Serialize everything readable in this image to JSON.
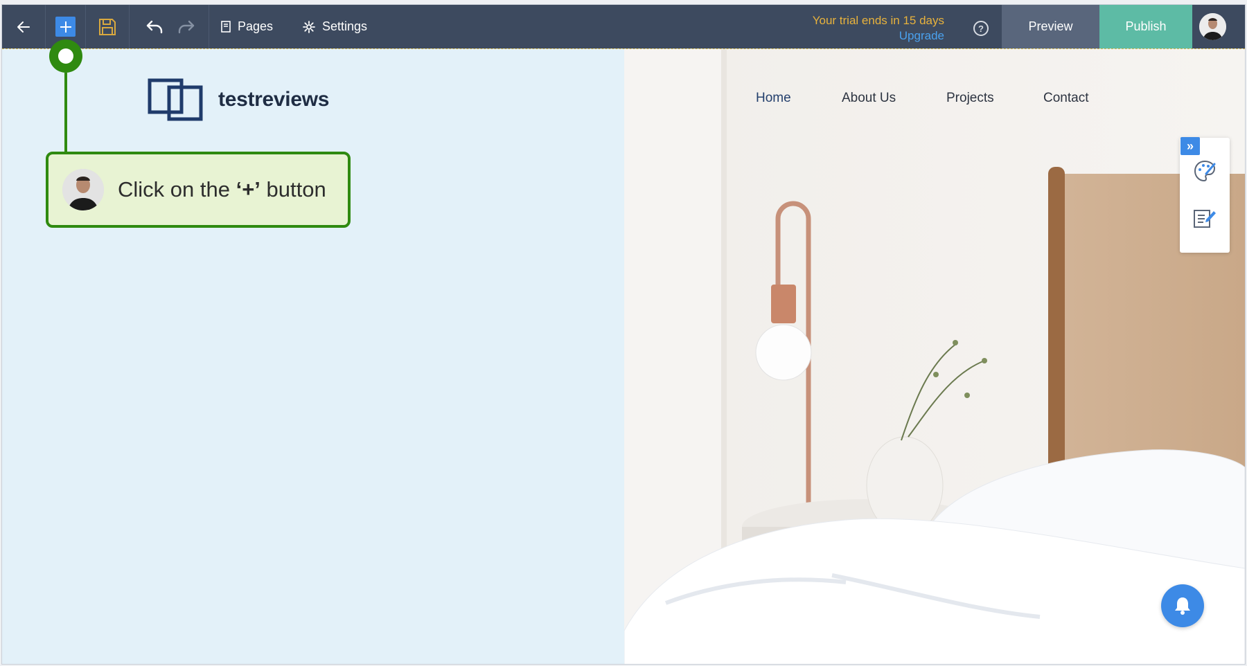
{
  "toolbar": {
    "back_icon": "arrow-left-icon",
    "add_icon": "plus-icon",
    "save_icon": "floppy-disk-icon",
    "undo_icon": "undo-icon",
    "redo_icon": "redo-icon",
    "pages_label": "Pages",
    "settings_label": "Settings",
    "trial_text": "Your trial ends in 15 days",
    "upgrade_label": "Upgrade",
    "help_label": "?",
    "preview_label": "Preview",
    "publish_label": "Publish"
  },
  "site": {
    "logo_text": "testreviews",
    "nav": [
      "Home",
      "About Us",
      "Projects",
      "Contact"
    ]
  },
  "side_panel": {
    "toggle_label": "»",
    "tools": [
      "palette-icon",
      "edit-content-icon"
    ]
  },
  "tutorial": {
    "tip_prefix": "Click on the ",
    "tip_emphasis": "‘+’",
    "tip_suffix": " button"
  },
  "colors": {
    "toolbar": "#3d4a5f",
    "accent_blue": "#3d8ae6",
    "publish_green": "#5dbba5",
    "trial_orange": "#e8b23c",
    "tutorial_green": "#2f8a10",
    "canvas_bg": "#e3f1f9"
  }
}
